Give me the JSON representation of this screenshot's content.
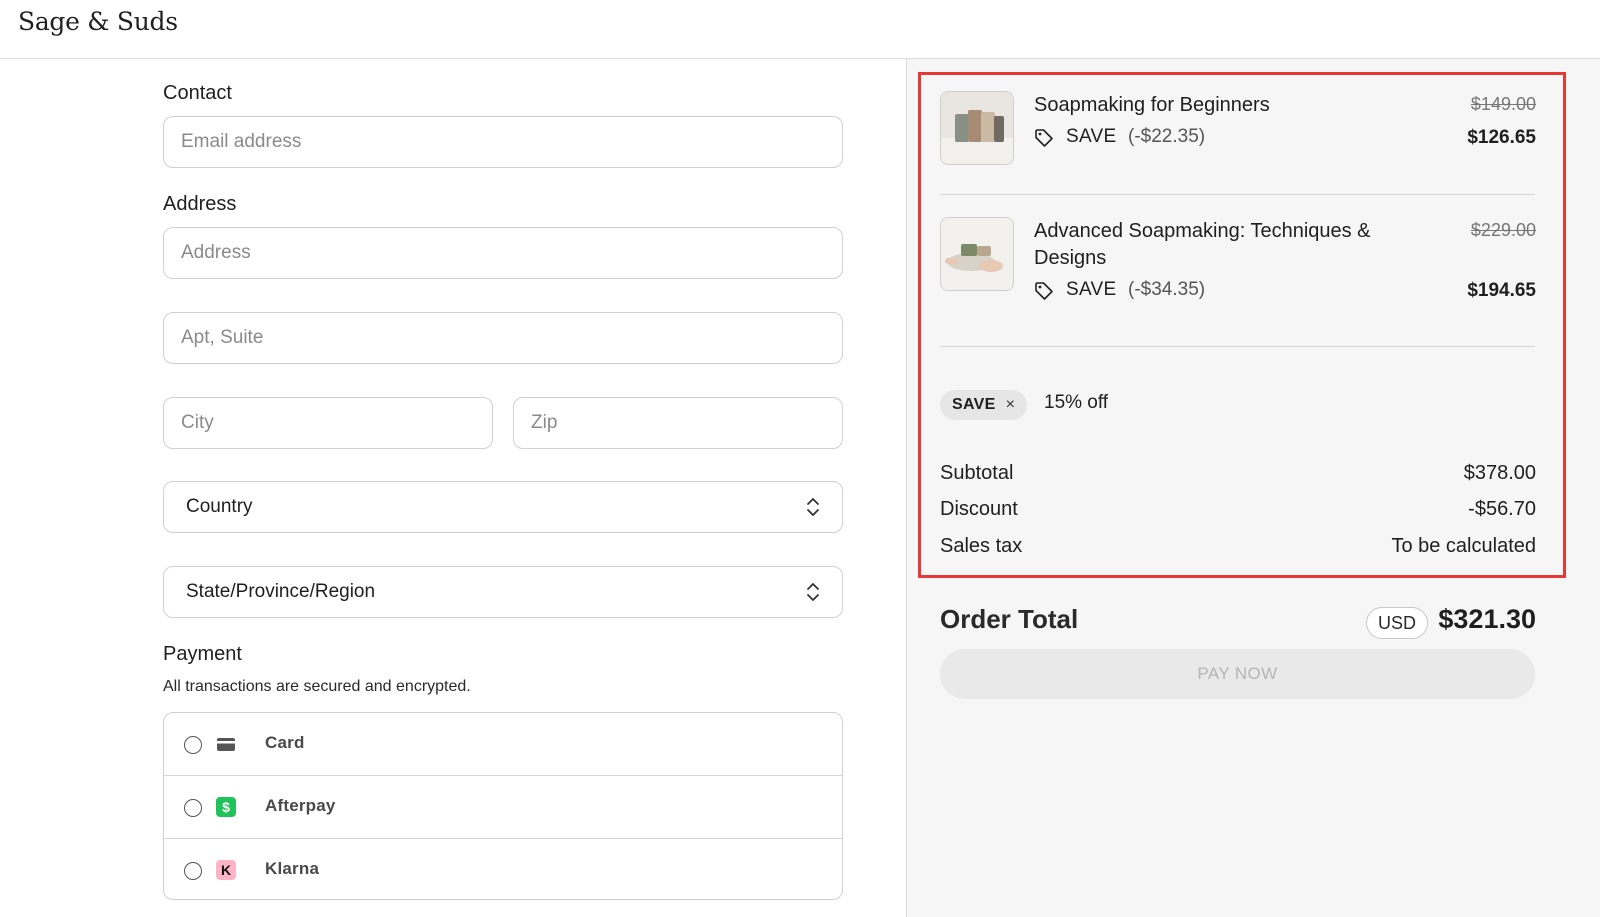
{
  "header": {
    "logo_text": "Sage & Suds"
  },
  "form": {
    "contact_label": "Contact",
    "email_placeholder": "Email address",
    "address_label": "Address",
    "address_placeholder": "Address",
    "apt_placeholder": "Apt, Suite",
    "city_placeholder": "City",
    "zip_placeholder": "Zip",
    "country_value": "Country",
    "state_value": "State/Province/Region",
    "payment_label": "Payment",
    "payment_note": "All transactions are secured and encrypted.",
    "payment_methods": [
      {
        "label": "Card",
        "icon": "credit-card-icon"
      },
      {
        "label": "Afterpay",
        "icon": "afterpay-icon",
        "icon_glyph": "$",
        "color": "#1fc35a"
      },
      {
        "label": "Klarna",
        "icon": "klarna-icon",
        "icon_glyph": "K",
        "color": "#ffb3c7"
      }
    ]
  },
  "order": {
    "items": [
      {
        "title": "Soapmaking for Beginners",
        "discount_code": "SAVE",
        "discount_amount": "(-$22.35)",
        "original_price": "$149.00",
        "price": "$126.65"
      },
      {
        "title": "Advanced Soapmaking: Techniques & Designs",
        "discount_code": "SAVE",
        "discount_amount": "(-$34.35)",
        "original_price": "$229.00",
        "price": "$194.65"
      }
    ],
    "applied_code": "SAVE",
    "applied_code_remove": "×",
    "applied_description": "15% off",
    "subtotal_label": "Subtotal",
    "subtotal_value": "$378.00",
    "discount_label": "Discount",
    "discount_value": "-$56.70",
    "tax_label": "Sales tax",
    "tax_value": "To be calculated",
    "total_label": "Order Total",
    "currency": "USD",
    "total_value": "$321.30",
    "pay_button": "PAY NOW"
  },
  "colors": {
    "highlight": "#e53935",
    "panel_bg": "#f6f6f6",
    "afterpay": "#1fc35a",
    "klarna": "#ffb3c7"
  }
}
